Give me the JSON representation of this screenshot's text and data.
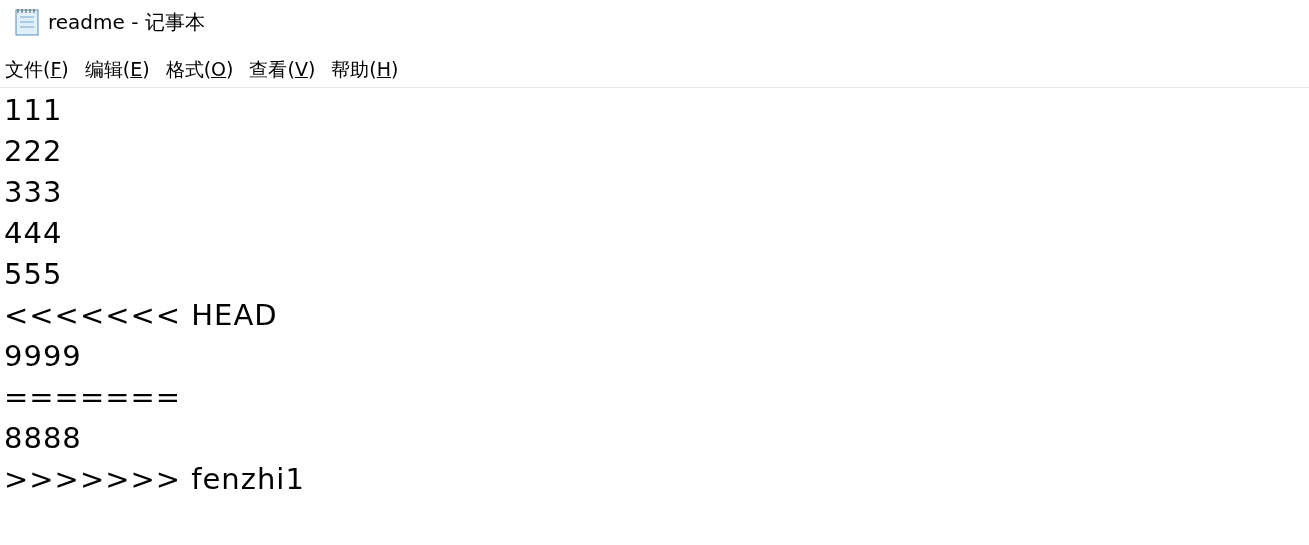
{
  "window": {
    "title": "readme - 记事本"
  },
  "menu": [
    {
      "before": "文件(",
      "key": "F",
      "after": ")"
    },
    {
      "before": "编辑(",
      "key": "E",
      "after": ")"
    },
    {
      "before": "格式(",
      "key": "O",
      "after": ")"
    },
    {
      "before": "查看(",
      "key": "V",
      "after": ")"
    },
    {
      "before": "帮助(",
      "key": "H",
      "after": ")"
    }
  ],
  "editor": {
    "lines": [
      "111",
      "222",
      "333",
      "444",
      "555",
      "<<<<<<< HEAD",
      "9999",
      "=======",
      "8888",
      ">>>>>>> fenzhi1"
    ]
  }
}
